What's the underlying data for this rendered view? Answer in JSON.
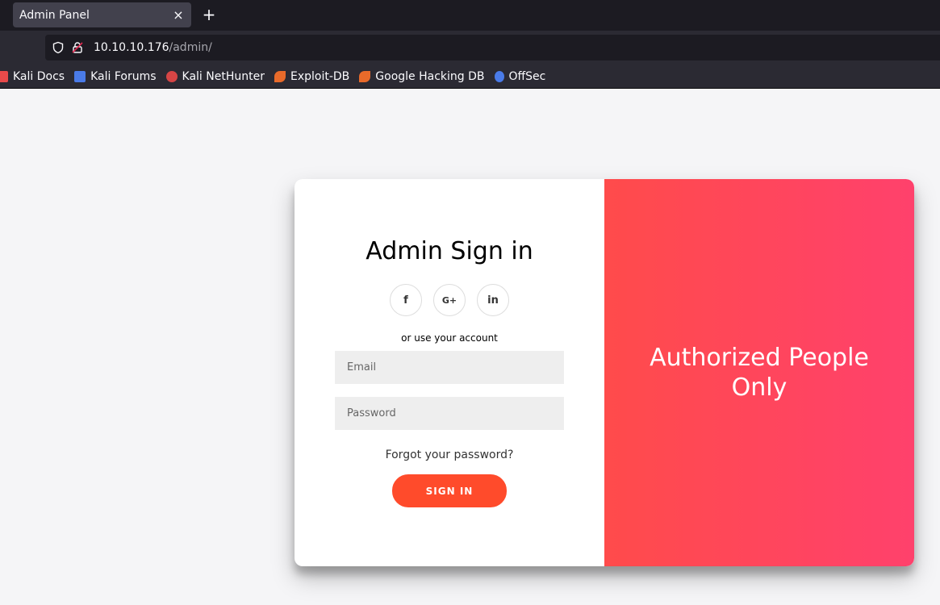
{
  "browser": {
    "tab": {
      "title": "Admin Panel",
      "close": "×"
    },
    "new_tab": "+",
    "url": {
      "host": "10.10.10.176",
      "path": "/admin/"
    },
    "bookmarks": [
      {
        "label": "Kali Docs",
        "icon": "kali-docs-icon",
        "color": "#e84a4a"
      },
      {
        "label": "Kali Forums",
        "icon": "kali-forums-icon",
        "color": "#4a7be8"
      },
      {
        "label": "Kali NetHunter",
        "icon": "kali-nethunter-icon",
        "color": "#d64545"
      },
      {
        "label": "Exploit-DB",
        "icon": "exploit-db-icon",
        "color": "#e86a2a"
      },
      {
        "label": "Google Hacking DB",
        "icon": "ghdb-icon",
        "color": "#e86a2a"
      },
      {
        "label": "OffSec",
        "icon": "offsec-icon",
        "color": "#4a7be8"
      }
    ]
  },
  "login": {
    "title": "Admin Sign in",
    "socials": [
      {
        "glyph": "f",
        "icon": "facebook-icon"
      },
      {
        "glyph": "G+",
        "icon": "google-plus-icon"
      },
      {
        "glyph": "in",
        "icon": "linkedin-icon"
      }
    ],
    "hint": "or use your account",
    "email_placeholder": "Email",
    "password_placeholder": "Password",
    "forgot": "Forgot your password?",
    "submit": "SIGN IN"
  },
  "overlay": {
    "title": "Authorized People Only"
  },
  "colors": {
    "accent": "#ff4b2b",
    "gradient_start": "#ff4b4b",
    "gradient_end": "#ff416c"
  }
}
